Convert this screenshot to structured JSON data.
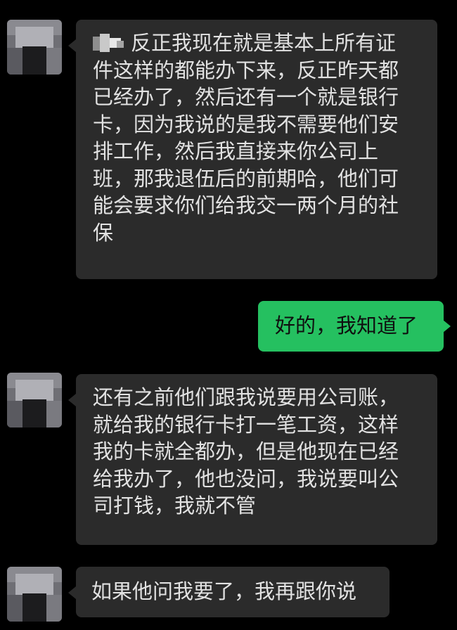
{
  "messages": [
    {
      "sender": "other",
      "lines": [
        "反正我现在就是基本上所有证",
        "件这样的都能办下来，反正昨天都",
        "已经办了，然后还有一个就是银行",
        "卡，因为我说的是我不需要他们安",
        "排工作，然后我直接来你公司上",
        "班，那我退伍后的前期哈，他们可",
        "能会要求你们给我交一两个月的社",
        "保"
      ]
    },
    {
      "sender": "self",
      "lines": [
        "好的，我知道了"
      ]
    },
    {
      "sender": "other",
      "lines": [
        "还有之前他们跟我说要用公司账，",
        "就给我的银行卡打一笔工资，这样",
        "我的卡就全都办，但是他现在已经",
        "给我办了，他也没问，我说要叫公",
        "司打钱，我就不管"
      ]
    },
    {
      "sender": "other",
      "lines": [
        "如果他问我要了，我再跟你说"
      ]
    }
  ],
  "colors": {
    "background": "#000000",
    "received_bubble": "#2b2b2b",
    "sent_bubble": "#25c060",
    "received_text": "#e2e2e2",
    "sent_text": "#0f0f0f"
  }
}
